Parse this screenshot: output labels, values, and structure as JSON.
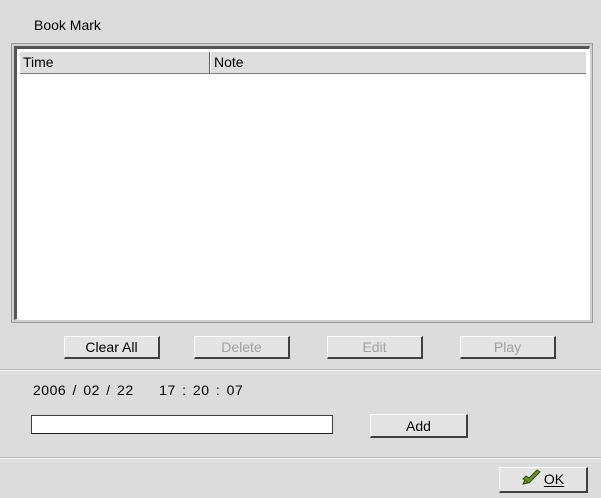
{
  "window": {
    "title": "Book Mark"
  },
  "list": {
    "columns": [
      "Time",
      "Note"
    ],
    "rows": []
  },
  "buttons": {
    "clear_all": "Clear All",
    "delete": "Delete",
    "edit": "Edit",
    "play": "Play",
    "add": "Add",
    "ok": "OK"
  },
  "datetime": {
    "text": "2006 / 02 / 22    17 : 20 : 07"
  },
  "note_input": {
    "value": ""
  },
  "icons": {
    "ok": "checkmark-arrow-icon"
  },
  "colors": {
    "ok_icon": "#5a7a2a"
  }
}
